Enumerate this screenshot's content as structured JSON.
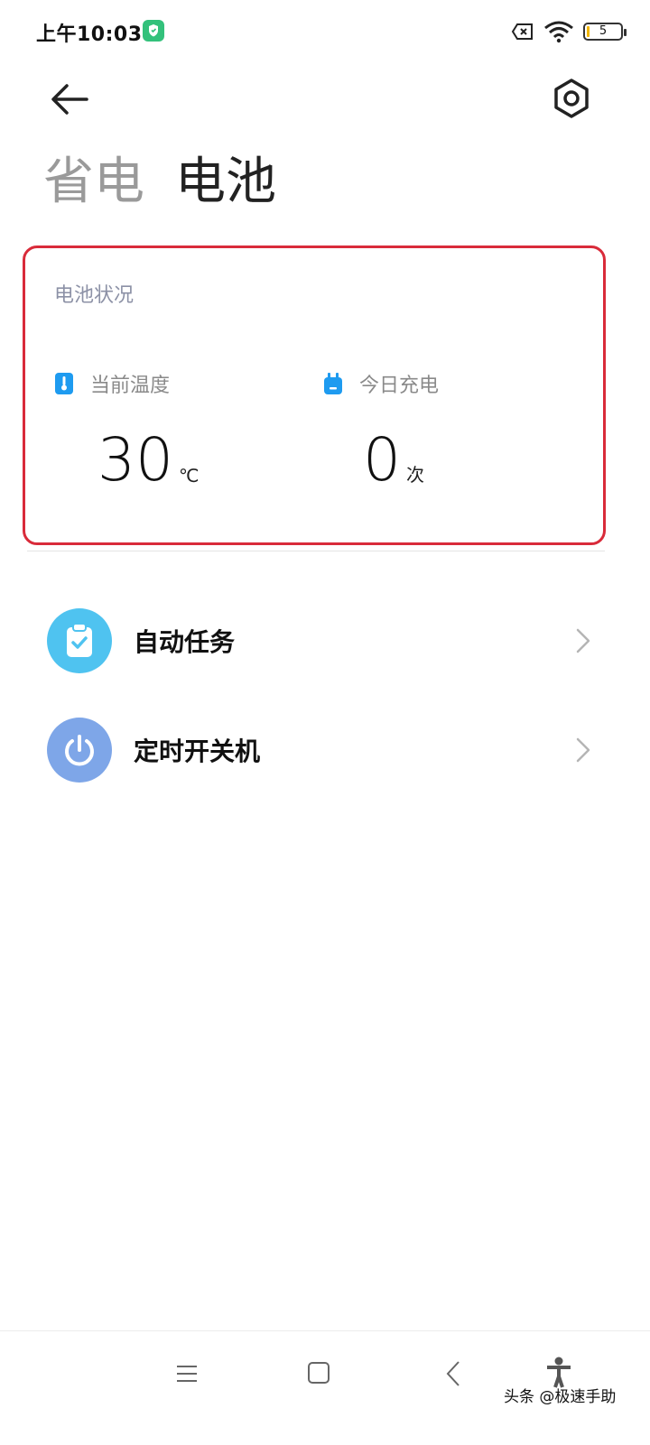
{
  "status_bar": {
    "time": "上午10:03",
    "battery_level": "5",
    "icons": [
      "shield-icon",
      "sim-off-icon",
      "wifi-icon",
      "battery-icon"
    ]
  },
  "header": {
    "back_icon": "arrow-left-icon",
    "settings_icon": "hexagon-gear-icon"
  },
  "tabs": [
    {
      "label": "省电",
      "active": false
    },
    {
      "label": "电池",
      "active": true
    }
  ],
  "battery_card": {
    "title": "电池状况",
    "stats": [
      {
        "label": "当前温度",
        "value": "30",
        "unit": "℃",
        "icon": "thermometer-icon"
      },
      {
        "label": "今日充电",
        "value": "0",
        "unit": "次",
        "icon": "plug-icon"
      }
    ],
    "highlight_color": "#d92b3a"
  },
  "menu_items": [
    {
      "label": "自动任务",
      "icon": "clipboard-check-icon",
      "icon_bg": "#4fc3f0"
    },
    {
      "label": "定时开关机",
      "icon": "power-icon",
      "icon_bg": "#7ea6e8"
    }
  ],
  "nav_bar": {
    "watermark": "头条 @极速手助"
  },
  "colors": {
    "accent_blue": "#1e9bf0",
    "text_primary": "#111111",
    "text_secondary": "#8a8a8a"
  }
}
